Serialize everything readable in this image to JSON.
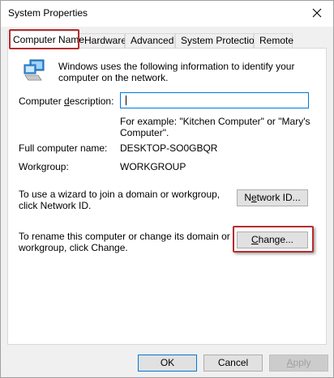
{
  "window": {
    "title": "System Properties"
  },
  "tabs": [
    {
      "label": "Computer Name",
      "active": true
    },
    {
      "label": "Hardware"
    },
    {
      "label": "Advanced"
    },
    {
      "label": "System Protection"
    },
    {
      "label": "Remote"
    }
  ],
  "panel": {
    "intro": "Windows uses the following information to identify your computer on the network.",
    "description_label_pre": "Computer ",
    "description_label_accel": "d",
    "description_label_post": "escription:",
    "description_value": "",
    "example": "For example: \"Kitchen Computer\" or \"Mary's Computer\".",
    "full_name_label": "Full computer name:",
    "full_name_value": "DESKTOP-SO0GBQR",
    "workgroup_label": "Workgroup:",
    "workgroup_value": "WORKGROUP",
    "wizard_text": "To use a wizard to join a domain or workgroup, click Network ID.",
    "network_id_pre": "N",
    "network_id_accel": "e",
    "network_id_post": "twork ID...",
    "rename_text": "To rename this computer or change its domain or workgroup, click Change.",
    "change_accel": "C",
    "change_post": "hange..."
  },
  "footer": {
    "ok_label": "OK",
    "cancel_label": "Cancel",
    "apply_accel": "A",
    "apply_post": "pply"
  },
  "icons": {
    "close": "close-icon",
    "computer": "computer-icon"
  },
  "colors": {
    "highlight": "#b52d2d",
    "focus": "#0078d7"
  }
}
